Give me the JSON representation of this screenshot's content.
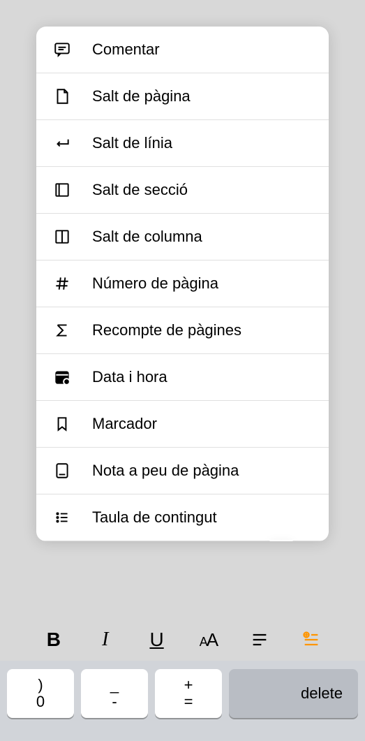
{
  "menu": {
    "items": [
      {
        "icon": "comment",
        "label": "Comentar"
      },
      {
        "icon": "page-break",
        "label": "Salt de pàgina"
      },
      {
        "icon": "line-break",
        "label": "Salt de línia"
      },
      {
        "icon": "section-break",
        "label": "Salt de secció"
      },
      {
        "icon": "column-break",
        "label": "Salt de columna"
      },
      {
        "icon": "page-number",
        "label": "Número de pàgina"
      },
      {
        "icon": "page-count",
        "label": "Recompte de pàgines"
      },
      {
        "icon": "date-time",
        "label": "Data i hora"
      },
      {
        "icon": "bookmark",
        "label": "Marcador"
      },
      {
        "icon": "footnote",
        "label": "Nota a peu de pàgina"
      },
      {
        "icon": "toc",
        "label": "Taula de contingut"
      }
    ]
  },
  "toolbar": {
    "bold": "B",
    "italic": "I",
    "underline": "U",
    "textsize": "AA"
  },
  "keyboard": {
    "key0": {
      "top": ")",
      "bottom": "0"
    },
    "key1": {
      "top": "_",
      "bottom": "-"
    },
    "key2": {
      "top": "+",
      "bottom": "="
    },
    "delete": "delete"
  }
}
